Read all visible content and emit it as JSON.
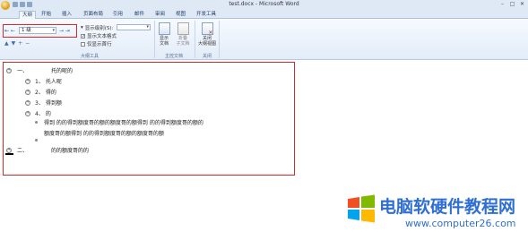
{
  "window": {
    "title": "test.docx - Microsoft Word",
    "controls": [
      "–",
      "□",
      "✕"
    ]
  },
  "tabs": [
    "大纲",
    "开始",
    "插入",
    "页面布局",
    "引用",
    "邮件",
    "审阅",
    "视图",
    "开发工具"
  ],
  "ribbon": {
    "outline_tools": {
      "level_value": "1 级",
      "show_level_label": "显示级别(S):",
      "show_text_format_label": "显示文本格式",
      "show_first_line_label": "仅显示首行",
      "group_label": "大纲工具"
    },
    "master_doc": {
      "show_doc_label": "显示\n文档",
      "collapse_subdocs_label": "折叠\n子文档",
      "group_label": "主控文档"
    },
    "close": {
      "close_outline_label": "关闭\n大纲视图",
      "group_label": "关闭"
    }
  },
  "outline": {
    "items": [
      {
        "num": "一、",
        "text": "托的呢的"
      },
      {
        "num": "1、",
        "text": "托人呢"
      },
      {
        "num": "2、",
        "text": "得的"
      },
      {
        "num": "3、",
        "text": "得到额"
      },
      {
        "num": "4、",
        "text": "的"
      },
      {
        "text": "得到 的的得到额度哥的额的额度哥的额得到 的的得到额度哥的额的"
      },
      {
        "text": "额度哥的额得到 的的得到额度哥的额的额度哥的额"
      },
      {
        "num": "二、",
        "text": "的的额度哥的的"
      }
    ]
  },
  "watermark": {
    "title": "电脑软硬件教程网",
    "url": "www.computer26.com",
    "colors": {
      "red": "#f25022",
      "green": "#7fba00",
      "blue": "#00a4ef",
      "yellow": "#ffb900"
    }
  }
}
